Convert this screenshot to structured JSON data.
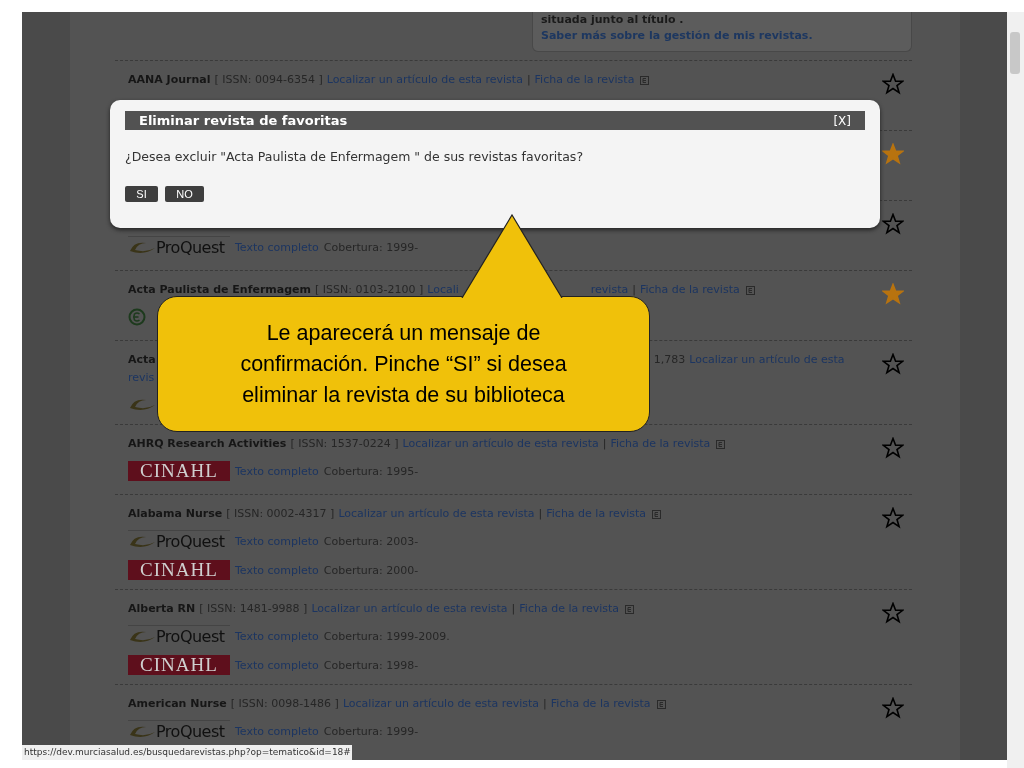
{
  "tooltip": {
    "text": "situada junto al título .",
    "link": "Saber más sobre la gestión de mis revistas."
  },
  "rows": [
    {
      "segments": [
        {
          "kind": "title",
          "text": "AANA Journal"
        },
        {
          "kind": "text",
          "text": "[ ISSN: 0094-6354 ]"
        },
        {
          "kind": "link",
          "text": "Localizar un artículo de esta revista"
        },
        {
          "kind": "text",
          "text": "|"
        },
        {
          "kind": "link",
          "text": "Ficha de la revista"
        },
        {
          "kind": "info"
        }
      ],
      "sources": [],
      "favorite": false
    },
    {
      "segments": [],
      "sources": [],
      "favorite": true
    },
    {
      "segments": [],
      "sources": [
        {
          "kind": "proquest",
          "logo": "ProQuest",
          "link": "Texto completo",
          "text": "Cobertura: 1999-"
        }
      ],
      "favorite": false
    },
    {
      "segments": [
        {
          "kind": "title",
          "text": "Acta Paulista de Enfermagem"
        },
        {
          "kind": "text",
          "text": "[ ISSN: 0103-2100 ]"
        },
        {
          "kind": "link",
          "text": "Locali"
        },
        {
          "kind": "gap"
        },
        {
          "kind": "link",
          "text": "revista"
        },
        {
          "kind": "text",
          "text": "|"
        },
        {
          "kind": "link",
          "text": "Ficha de la revista"
        },
        {
          "kind": "info"
        }
      ],
      "sources": [
        {
          "kind": "free"
        }
      ],
      "favorite": true
    },
    {
      "segments": [
        {
          "kind": "title",
          "text": "Acta"
        },
        {
          "kind": "wide-gap"
        },
        {
          "kind": "text",
          "text": "1,783"
        },
        {
          "kind": "link",
          "text": "Localizar un artículo de esta"
        },
        {
          "kind": "break"
        },
        {
          "kind": "link",
          "text": "revis"
        }
      ],
      "sources": [
        {
          "kind": "swoosh"
        }
      ],
      "favorite": false
    },
    {
      "segments": [
        {
          "kind": "title",
          "text": "AHRQ Research Activities"
        },
        {
          "kind": "text",
          "text": "[ ISSN: 1537-0224 ]"
        },
        {
          "kind": "link",
          "text": "Localizar un artículo de esta revista"
        },
        {
          "kind": "text",
          "text": "|"
        },
        {
          "kind": "link",
          "text": "Ficha de la revista"
        },
        {
          "kind": "info"
        }
      ],
      "sources": [
        {
          "kind": "cinahl",
          "logo": "CINAHL",
          "link": "Texto completo",
          "text": "Cobertura: 1995-"
        }
      ],
      "favorite": false
    },
    {
      "segments": [
        {
          "kind": "title",
          "text": "Alabama Nurse"
        },
        {
          "kind": "text",
          "text": "[ ISSN: 0002-4317 ]"
        },
        {
          "kind": "link",
          "text": "Localizar un artículo de esta revista"
        },
        {
          "kind": "text",
          "text": "|"
        },
        {
          "kind": "link",
          "text": "Ficha de la revista"
        },
        {
          "kind": "info"
        }
      ],
      "sources": [
        {
          "kind": "proquest",
          "logo": "ProQuest",
          "link": "Texto completo",
          "text": "Cobertura: 2003-"
        },
        {
          "kind": "cinahl",
          "logo": "CINAHL",
          "link": "Texto completo",
          "text": "Cobertura: 2000-"
        }
      ],
      "favorite": false
    },
    {
      "segments": [
        {
          "kind": "title",
          "text": "Alberta RN"
        },
        {
          "kind": "text",
          "text": "[ ISSN: 1481-9988 ]"
        },
        {
          "kind": "link",
          "text": "Localizar un artículo de esta revista"
        },
        {
          "kind": "text",
          "text": "|"
        },
        {
          "kind": "link",
          "text": "Ficha de la revista"
        },
        {
          "kind": "info"
        }
      ],
      "sources": [
        {
          "kind": "proquest",
          "logo": "ProQuest",
          "link": "Texto completo",
          "text": "Cobertura: 1999-2009."
        },
        {
          "kind": "cinahl",
          "logo": "CINAHL",
          "link": "Texto completo",
          "text": "Cobertura: 1998-"
        }
      ],
      "favorite": false
    },
    {
      "segments": [
        {
          "kind": "title",
          "text": "American Nurse"
        },
        {
          "kind": "text",
          "text": "[ ISSN: 0098-1486 ]"
        },
        {
          "kind": "link",
          "text": "Localizar un artículo de esta revista"
        },
        {
          "kind": "text",
          "text": "|"
        },
        {
          "kind": "link",
          "text": "Ficha de la revista"
        },
        {
          "kind": "info"
        }
      ],
      "sources": [
        {
          "kind": "proquest",
          "logo": "ProQuest",
          "link": "Texto completo",
          "text": "Cobertura: 1999-"
        }
      ],
      "favorite": false
    }
  ],
  "dialog": {
    "title": "Eliminar revista de favoritas",
    "close": "[X]",
    "message": "¿Desea excluir \"Acta Paulista de Enfermagem \" de sus revistas favoritas?",
    "buttons": [
      "SI",
      "NO"
    ]
  },
  "callout": {
    "text": "Le aparecerá un mensaje de confirmación. Pinche “SI” si desea eliminar la revista de su biblioteca"
  },
  "status_bar": {
    "url": "https://dev.murciasalud.es/busquedarevistas.php?op=tematico&id=18#"
  }
}
